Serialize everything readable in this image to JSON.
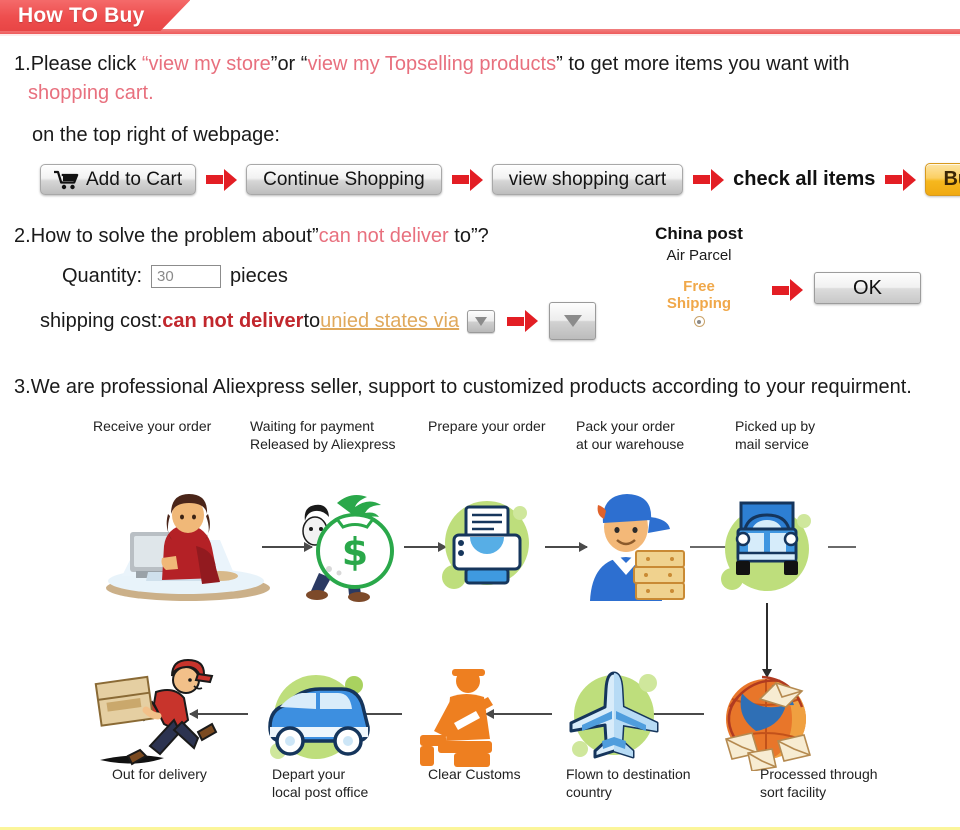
{
  "header": {
    "title": "How TO Buy",
    "accent_color": "#ee4e4e"
  },
  "colors": {
    "pink_text": "#e8707e",
    "dark_red_text": "#c1272d",
    "tan_link": "#e0a95c",
    "buy_now_orange": "#f6b81e",
    "flow_green": "#bede7c",
    "red_arrow": "#e31e24"
  },
  "section1": {
    "number": "1.",
    "lead": "Please click ",
    "quote_open_1": "“",
    "link1": "view my store",
    "quote_close_1": "”",
    "or": "or ",
    "quote_open_2": "“",
    "link2": "view my Topselling products",
    "quote_close_2": "”",
    "tail": " to get more items you want with",
    "line2": "shopping cart.",
    "line3": "on the top right of webpage:",
    "buttons": {
      "add_to_cart": "Add to Cart",
      "continue_shopping": "Continue Shopping",
      "view_shopping_cart": "view shopping cart",
      "check_all_items": "check all items",
      "buy_now": "Buy now"
    }
  },
  "section2": {
    "number": "2.",
    "heading_a": "How to solve the problem about",
    "heading_quote_open": "”",
    "heading_red": "can not deliver",
    "heading_b": " to",
    "heading_quote_close": "”?",
    "quantity_label": "Quantity:",
    "quantity_value": "30",
    "quantity_unit": "pieces",
    "shipping_label": "shipping cost:",
    "shipping_red": "can not deliver",
    "shipping_to": " to ",
    "shipping_country": "unied states via",
    "post_title": "China post",
    "post_sub": "Air Parcel",
    "free_shipping_line1": "Free",
    "free_shipping_line2": "Shipping",
    "ok_button": "OK"
  },
  "section3": {
    "number": "3.",
    "text": "We are professional Aliexpress seller, support to customized products according to your requirment."
  },
  "flow": {
    "steps_top": [
      {
        "label": "Receive your order",
        "icon": "person-at-computer-icon"
      },
      {
        "label": "Waiting for payment\nReleased by Aliexpress",
        "line1": "Waiting for payment",
        "line2": "Released by Aliexpress",
        "icon": "money-bag-icon"
      },
      {
        "label": "Prepare your order",
        "icon": "printer-icon"
      },
      {
        "label": "Pack your order\nat our warehouse",
        "line1": "Pack your order",
        "line2": "at our warehouse",
        "icon": "warehouse-worker-icon"
      },
      {
        "label": "Picked up by\nmail service",
        "line1": "Picked up by",
        "line2": "mail service",
        "icon": "truck-icon"
      }
    ],
    "steps_bottom": [
      {
        "label": "Out for delivery",
        "icon": "running-courier-icon"
      },
      {
        "label": "Depart your\nlocal post office",
        "line1": "Depart your",
        "line2": "local post office",
        "icon": "delivery-van-icon"
      },
      {
        "label": "Clear Customs",
        "icon": "customs-officer-icon"
      },
      {
        "label": "Flown to destination\ncountry",
        "line1": "Flown to destination",
        "line2": "country",
        "icon": "airplane-icon"
      },
      {
        "label": "Processed through\nsort facility",
        "line1": "Processed through",
        "line2": "sort facility",
        "icon": "globe-mail-icon"
      }
    ]
  }
}
